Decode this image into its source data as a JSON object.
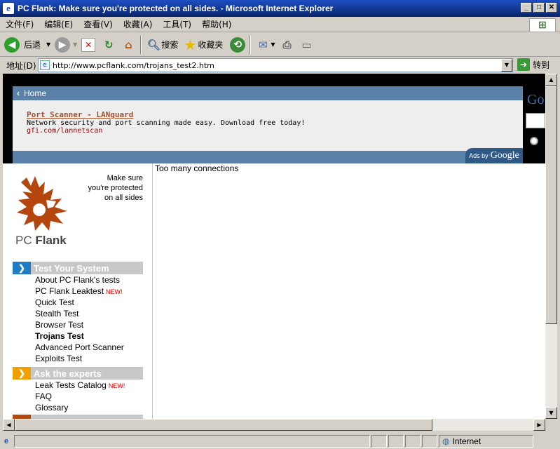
{
  "window": {
    "title": "PC Flank: Make sure you're protected on all sides. - Microsoft Internet Explorer"
  },
  "menu": [
    "文件(F)",
    "编辑(E)",
    "查看(V)",
    "收藏(A)",
    "工具(T)",
    "帮助(H)"
  ],
  "toolbar": {
    "back": "后退",
    "search": "搜索",
    "favorites": "收藏夹"
  },
  "address": {
    "label": "地址(D)",
    "url": "http://www.pcflank.com/trojans_test2.htm",
    "go": "转到"
  },
  "ad": {
    "home": "Home",
    "title": "Port Scanner - LANguard",
    "description": "Network security and port scanning made easy. Download free today!",
    "url": "gfi.com/lannetscan",
    "ads_by": "Ads by",
    "google": "Google",
    "google_side": "Go"
  },
  "logo": {
    "tagline": [
      "Make sure",
      "you're protected",
      "on all sides"
    ],
    "brand_pc": "PC",
    "brand_flank": "Flank"
  },
  "nav": {
    "section1": {
      "title": "Test Your System",
      "items": [
        "About PC Flank's tests",
        "PC Flank Leaktest",
        "Quick Test",
        "Stealth Test",
        "Browser Test",
        "Trojans Test",
        "Advanced Port Scanner",
        "Exploits Test"
      ],
      "new_badge": "NEW!"
    },
    "section2": {
      "title": "Ask the experts",
      "items": [
        "Leak Tests Catalog",
        "FAQ",
        "Glossary"
      ],
      "new_badge": "NEW!"
    }
  },
  "main": {
    "message": "Too many connections"
  },
  "status": {
    "zone": "Internet"
  },
  "colors": {
    "blue_band": "#5a82a8",
    "nav_blue": "#1e7bc4",
    "nav_orange": "#f0a000",
    "logo_brown": "#b5470e"
  }
}
